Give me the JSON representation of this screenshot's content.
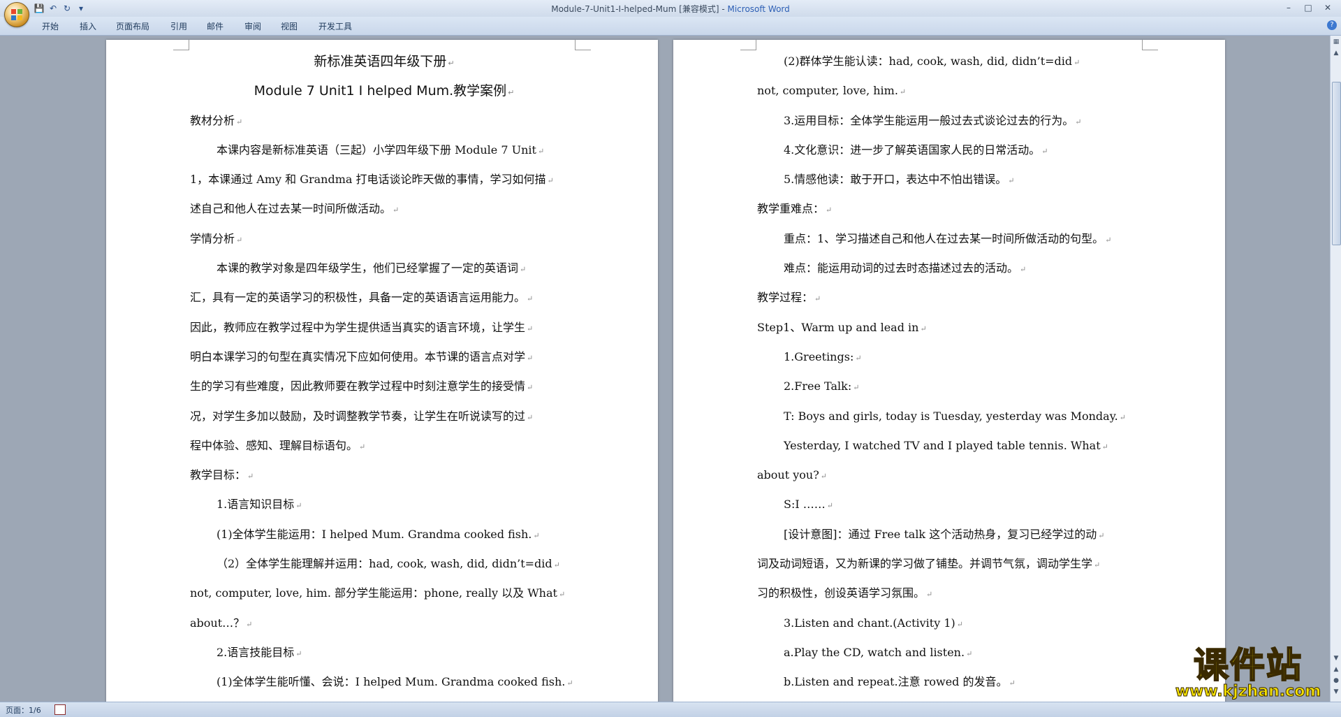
{
  "window": {
    "title": "Module-7-Unit1-I-helped-Mum [兼容模式]",
    "separator": " - ",
    "app_name": "Microsoft Word"
  },
  "ribbon": {
    "tabs": [
      "开始",
      "插入",
      "页面布局",
      "引用",
      "邮件",
      "审阅",
      "视图",
      "开发工具"
    ]
  },
  "document": {
    "left_page": [
      {
        "text": "新标准英语四年级下册",
        "style": "h1 center"
      },
      {
        "text": "Module 7 Unit1 I helped Mum.教学案例",
        "style": "h1 center"
      },
      {
        "text": "教材分析",
        "style": ""
      },
      {
        "text": "本课内容是新标准英语（三起）小学四年级下册 Module 7 Unit",
        "style": "ind"
      },
      {
        "text": "1，本课通过 Amy 和 Grandma 打电话谈论昨天做的事情，学习如何描",
        "style": ""
      },
      {
        "text": "述自己和他人在过去某一时间所做活动。",
        "style": ""
      },
      {
        "text": "学情分析",
        "style": ""
      },
      {
        "text": "本课的教学对象是四年级学生，他们已经掌握了一定的英语词",
        "style": "ind"
      },
      {
        "text": "汇，具有一定的英语学习的积极性，具备一定的英语语言运用能力。",
        "style": ""
      },
      {
        "text": "因此，教师应在教学过程中为学生提供适当真实的语言环境，让学生",
        "style": ""
      },
      {
        "text": "明白本课学习的句型在真实情况下应如何使用。本节课的语言点对学",
        "style": ""
      },
      {
        "text": "生的学习有些难度，因此教师要在教学过程中时刻注意学生的接受情",
        "style": ""
      },
      {
        "text": "况，对学生多加以鼓励，及时调整教学节奏，让学生在听说读写的过",
        "style": ""
      },
      {
        "text": "程中体验、感知、理解目标语句。",
        "style": ""
      },
      {
        "text": "教学目标：",
        "style": ""
      },
      {
        "text": "1.语言知识目标",
        "style": "ind"
      },
      {
        "text": "(1)全体学生能运用：I helped Mum. Grandma cooked fish.",
        "style": "ind"
      },
      {
        "text": "（2）全体学生能理解并运用：had, cook, wash, did, didn’t=did",
        "style": "ind"
      },
      {
        "text": "not, computer, love, him. 部分学生能运用：phone, really 以及 What",
        "style": ""
      },
      {
        "text": "about…？",
        "style": ""
      },
      {
        "text": "2.语言技能目标",
        "style": "ind"
      },
      {
        "text": "(1)全体学生能听懂、会说：I helped Mum. Grandma cooked fish.",
        "style": "ind"
      }
    ],
    "right_page": [
      {
        "text": "(2)群体学生能认读：had, cook, wash, did, didn’t=did",
        "style": "ind"
      },
      {
        "text": "not, computer, love, him.",
        "style": ""
      },
      {
        "text": "3.运用目标：全体学生能运用一般过去式谈论过去的行为。",
        "style": "ind"
      },
      {
        "text": "4.文化意识：进一步了解英语国家人民的日常活动。",
        "style": "ind"
      },
      {
        "text": "5.情感他读：敢于开口，表达中不怕出错误。",
        "style": "ind"
      },
      {
        "text": "教学重难点：",
        "style": ""
      },
      {
        "text": "重点：1、学习描述自己和他人在过去某一时间所做活动的句型。",
        "style": "ind"
      },
      {
        "text": "难点：能运用动词的过去时态描述过去的活动。",
        "style": "ind"
      },
      {
        "text": "教学过程：",
        "style": ""
      },
      {
        "text": "Step1、Warm  up and lead in",
        "style": ""
      },
      {
        "text": "1.Greetings:",
        "style": "ind"
      },
      {
        "text": "2.Free Talk:",
        "style": "ind"
      },
      {
        "text": "T: Boys and girls, today is Tuesday, yesterday was Monday.",
        "style": "ind"
      },
      {
        "text": "Yesterday, I watched TV and I played table tennis. What",
        "style": "ind"
      },
      {
        "text": "about you?",
        "style": ""
      },
      {
        "text": "S:I ……",
        "style": "ind"
      },
      {
        "text": "[设计意图]：通过 Free talk 这个活动热身，复习已经学过的动",
        "style": "ind"
      },
      {
        "text": "词及动词短语，又为新课的学习做了铺垫。并调节气氛，调动学生学",
        "style": ""
      },
      {
        "text": "习的积极性，创设英语学习氛围。",
        "style": ""
      },
      {
        "text": "3.Listen and chant.(Activity 1)",
        "style": "ind"
      },
      {
        "text": "a.Play the CD, watch and listen.",
        "style": "ind"
      },
      {
        "text": "b.Listen and repeat.注意 rowed 的发音。",
        "style": "ind"
      }
    ]
  },
  "status": {
    "page_info": "页面：1/6"
  },
  "watermark": {
    "brand": "课件站",
    "url": "www.kjzhan.com"
  }
}
